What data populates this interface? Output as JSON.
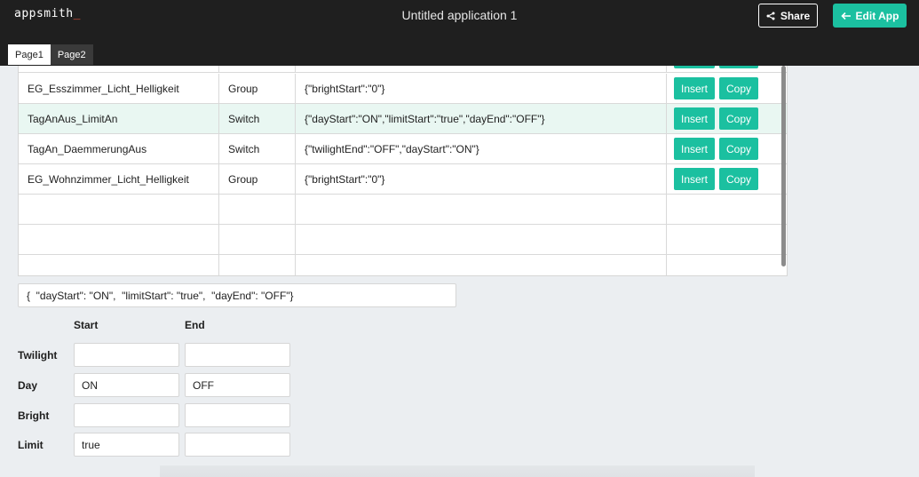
{
  "header": {
    "logo": "appsmith",
    "logo_cursor": "_",
    "title": "Untitled application 1",
    "share_label": "Share",
    "edit_label": "Edit App",
    "accent_color": "#1bc0a0"
  },
  "tabs": [
    {
      "label": "Page1",
      "active": true
    },
    {
      "label": "Page2",
      "active": false
    }
  ],
  "table": {
    "rows": [
      {
        "name": "",
        "type": "",
        "json": "",
        "insert": "",
        "copy": ""
      },
      {
        "name": "EG_Esszimmer_Licht_Helligkeit",
        "type": "Group",
        "json": "{\"brightStart\":\"0\"}",
        "insert": "Insert",
        "copy": "Copy"
      },
      {
        "name": "TagAnAus_LimitAn",
        "type": "Switch",
        "json": "{\"dayStart\":\"ON\",\"limitStart\":\"true\",\"dayEnd\":\"OFF\"}",
        "insert": "Insert",
        "copy": "Copy"
      },
      {
        "name": "TagAn_DaemmerungAus",
        "type": "Switch",
        "json": "{\"twilightEnd\":\"OFF\",\"dayStart\":\"ON\"}",
        "insert": "Insert",
        "copy": "Copy"
      },
      {
        "name": "EG_Wohnzimmer_Licht_Helligkeit",
        "type": "Group",
        "json": "{\"brightStart\":\"0\"}",
        "insert": "Insert",
        "copy": "Copy"
      }
    ]
  },
  "json_text": "{  \"dayStart\": \"ON\",  \"limitStart\": \"true\",  \"dayEnd\": \"OFF\"}",
  "form": {
    "col_start": "Start",
    "col_end": "End",
    "rows": [
      {
        "label": "Twilight",
        "start": "",
        "end": ""
      },
      {
        "label": "Day",
        "start": "ON",
        "end": "OFF"
      },
      {
        "label": "Bright",
        "start": "",
        "end": ""
      },
      {
        "label": "Limit",
        "start": "true",
        "end": ""
      }
    ]
  }
}
